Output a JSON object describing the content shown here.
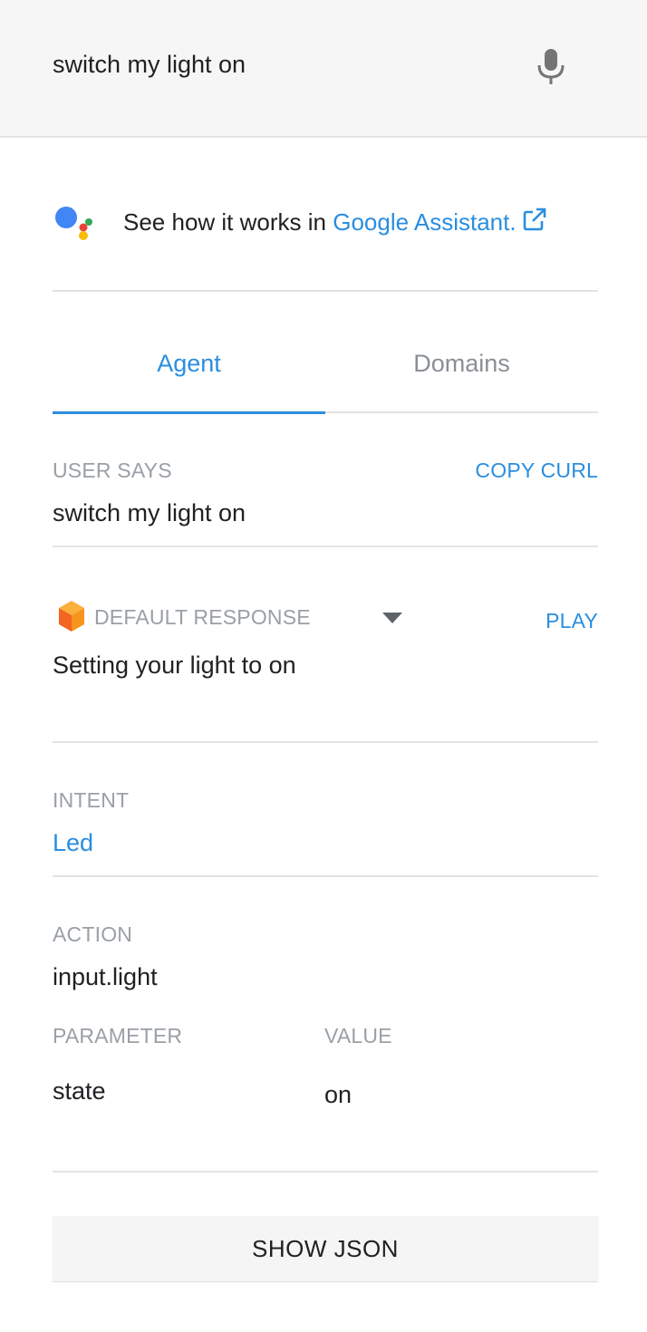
{
  "query": {
    "text": "switch my light on",
    "mic_icon": "microphone-icon"
  },
  "assistant_banner": {
    "prefix": "See how it works in ",
    "link_text": "Google Assistant.",
    "logo_icon": "google-assistant-icon",
    "link_icon": "external-link-icon"
  },
  "tabs": [
    {
      "label": "Agent",
      "active": true
    },
    {
      "label": "Domains",
      "active": false
    }
  ],
  "user_says": {
    "label": "USER SAYS",
    "action": "COPY CURL",
    "value": "switch my light on"
  },
  "response": {
    "icon": "cube-icon",
    "label": "DEFAULT RESPONSE",
    "action": "PLAY",
    "value": "Setting your light to on"
  },
  "intent": {
    "label": "INTENT",
    "value": "Led"
  },
  "action_section": {
    "label": "ACTION",
    "value": "input.light"
  },
  "parameters": {
    "header_param": "PARAMETER",
    "header_value": "VALUE",
    "rows": [
      {
        "param": "state",
        "value": "on"
      }
    ]
  },
  "show_json": "SHOW JSON",
  "colors": {
    "accent": "#2a8ee0",
    "muted": "#9aa0a6",
    "text": "#202124",
    "divider": "#e3e3e3"
  }
}
